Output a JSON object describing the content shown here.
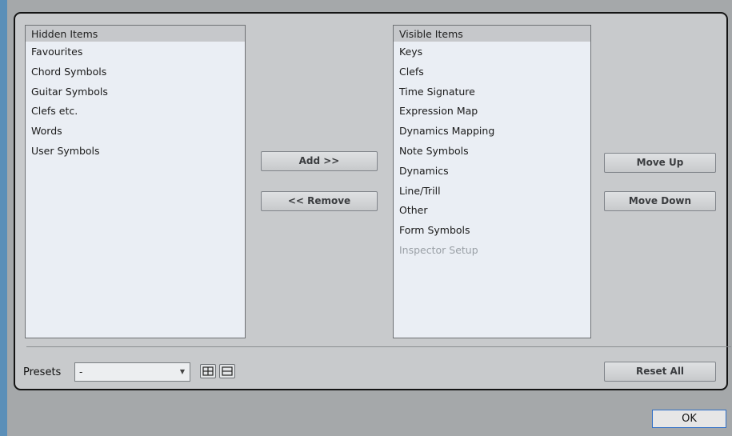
{
  "hidden_list": {
    "header": "Hidden Items",
    "items": [
      "Favourites",
      "Chord Symbols",
      "Guitar Symbols",
      "Clefs etc.",
      "Words",
      "User Symbols"
    ]
  },
  "visible_list": {
    "header": "Visible Items",
    "items": [
      "Keys",
      "Clefs",
      "Time Signature",
      "Expression Map",
      "Dynamics Mapping",
      "Note Symbols",
      "Dynamics",
      "Line/Trill",
      "Other",
      "Form Symbols"
    ],
    "disabled_item": "Inspector Setup"
  },
  "buttons": {
    "add": "Add >>",
    "remove": "<< Remove",
    "move_up": "Move Up",
    "move_down": "Move Down",
    "reset_all": "Reset All",
    "ok": "OK"
  },
  "presets": {
    "label": "Presets",
    "value": "-"
  }
}
